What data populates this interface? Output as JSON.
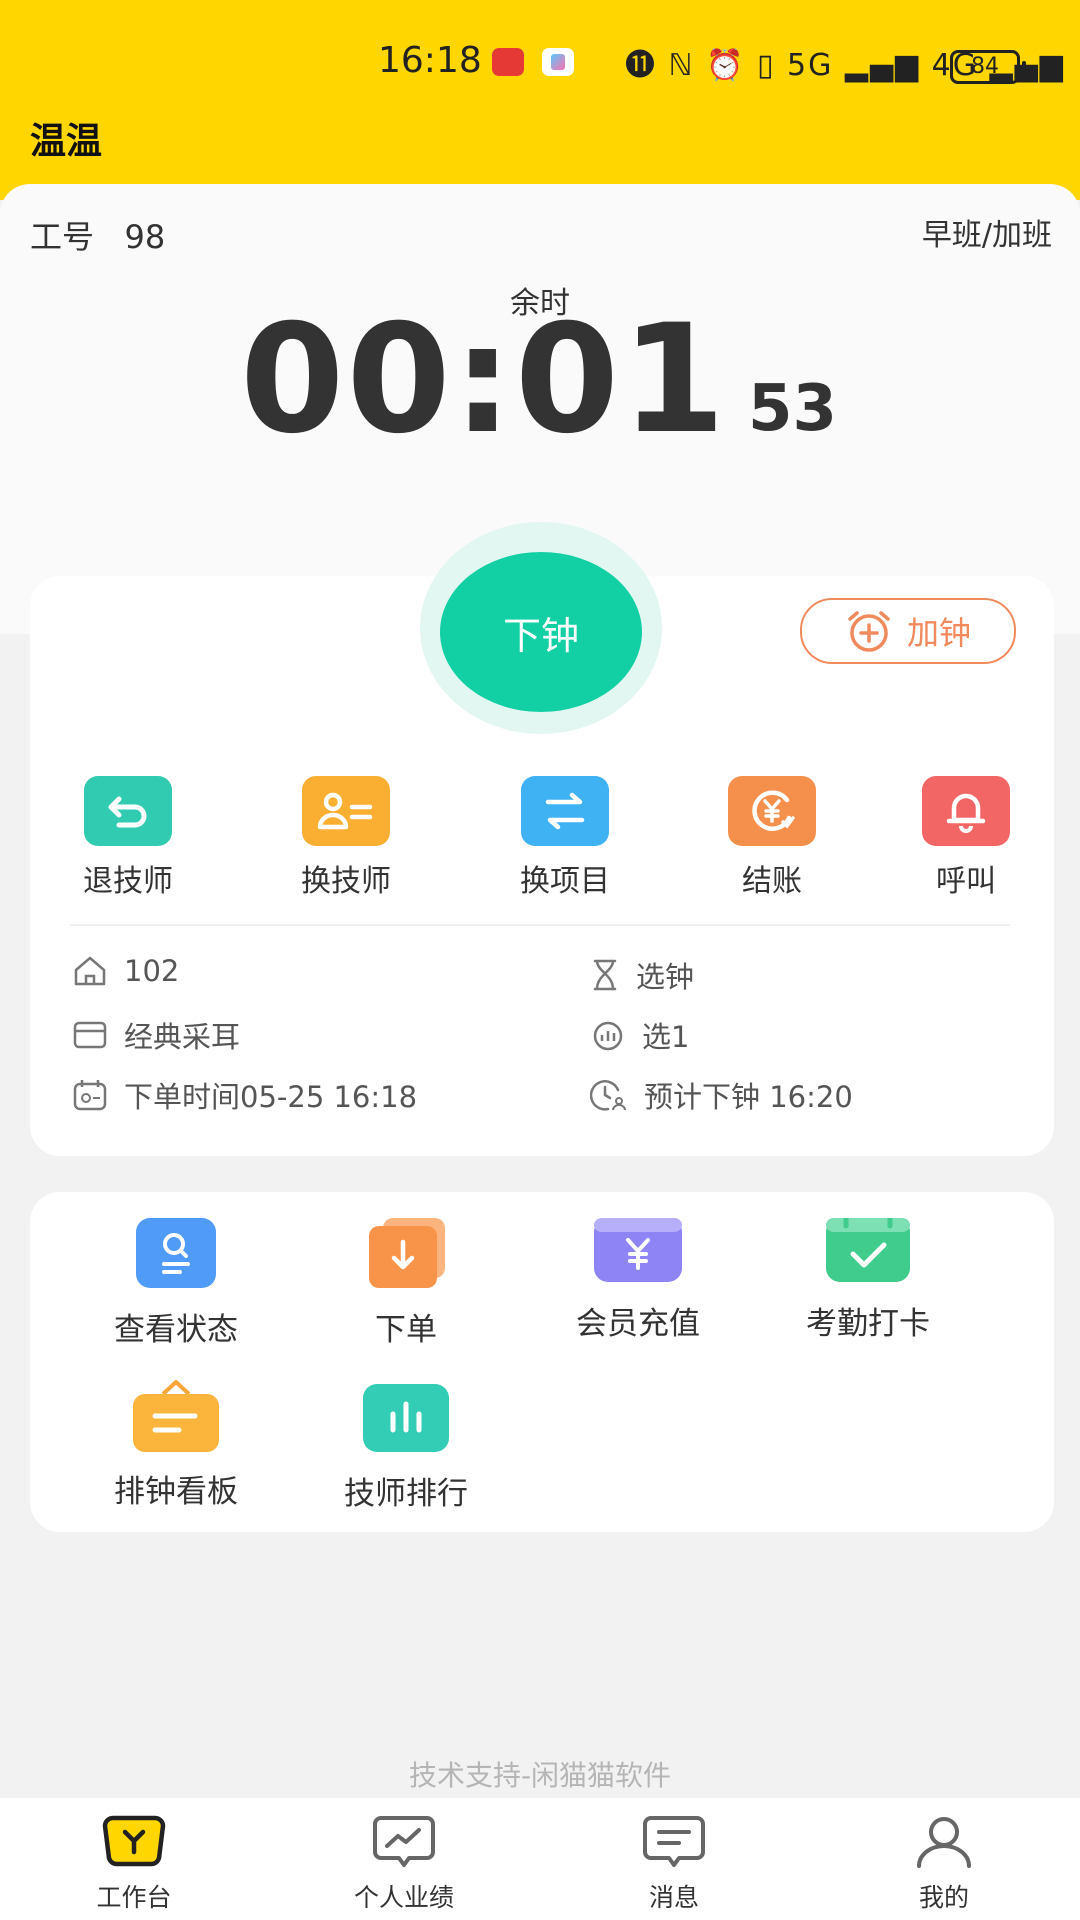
{
  "status_bar": {
    "time": "16:18",
    "indicators": "⓫ ℕ ⏰ ▯ 5G ▂▄▆ 4G ▂▄▆",
    "battery": "84"
  },
  "app": {
    "title": "温温"
  },
  "employee": {
    "label": "工号",
    "number": "98",
    "shift": "早班/加班"
  },
  "timer": {
    "label": "余时",
    "main": "00:01",
    "seconds": "53"
  },
  "controls": {
    "end_button": "下钟",
    "add_time_button": "加钟"
  },
  "quick_actions": [
    {
      "label": "退技师",
      "color": "#31CBB2",
      "icon": "return-icon"
    },
    {
      "label": "换技师",
      "color": "#FBAF32",
      "icon": "swap-person-icon"
    },
    {
      "label": "换项目",
      "color": "#3FB2F4",
      "icon": "swap-arrows-icon"
    },
    {
      "label": "结账",
      "color": "#F58F4C",
      "icon": "checkout-yen-icon"
    },
    {
      "label": "呼叫",
      "color": "#F36666",
      "icon": "bell-icon"
    }
  ],
  "order_info": {
    "room": "102",
    "clock_type": "选钟",
    "service": "经典采耳",
    "selection": "选1",
    "order_time": "下单时间05-25 16:18",
    "expected_end": "预计下钟 16:20"
  },
  "menu": [
    {
      "label": "查看状态",
      "color": "#4F9BF7",
      "icon": "search-doc-icon"
    },
    {
      "label": "下单",
      "color": "#F8934A",
      "icon": "download-icon"
    },
    {
      "label": "会员充值",
      "color": "#8F84F6",
      "icon": "wallet-yen-icon"
    },
    {
      "label": "考勤打卡",
      "color": "#3FCC8C",
      "icon": "calendar-check-icon"
    },
    {
      "label": "排钟看板",
      "color": "#FBB53C",
      "icon": "board-icon"
    },
    {
      "label": "技师排行",
      "color": "#33CDB6",
      "icon": "bar-chart-icon"
    }
  ],
  "footer_note": "技术支持-闲猫猫软件",
  "bottom_nav": [
    {
      "label": "工作台",
      "icon": "workbench-icon"
    },
    {
      "label": "个人业绩",
      "icon": "performance-icon"
    },
    {
      "label": "消息",
      "icon": "message-icon"
    },
    {
      "label": "我的",
      "icon": "profile-icon"
    }
  ],
  "colors": {
    "brand_yellow": "#FFD600",
    "primary_green": "#12CFA4",
    "accent_orange": "#F08A5D"
  }
}
